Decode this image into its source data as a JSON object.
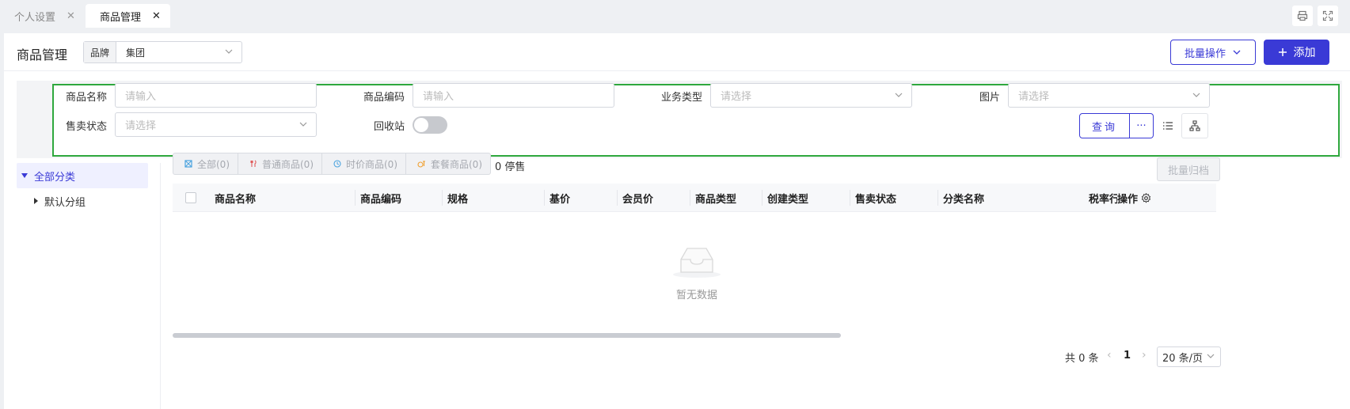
{
  "tabs": [
    {
      "label": "个人设置",
      "active": false
    },
    {
      "label": "商品管理",
      "active": true
    }
  ],
  "header": {
    "title": "商品管理",
    "brand_label": "品牌",
    "brand_value": "集团",
    "batch_label": "批量操作",
    "add_label": "添加"
  },
  "filters": {
    "product_name_label": "商品名称",
    "product_name_placeholder": "请输入",
    "product_code_label": "商品编码",
    "product_code_placeholder": "请输入",
    "business_type_label": "业务类型",
    "business_type_placeholder": "请选择",
    "image_label": "图片",
    "image_placeholder": "请选择",
    "sale_status_label": "售卖状态",
    "sale_status_placeholder": "请选择",
    "recycle_label": "回收站",
    "query_label": "查询",
    "more_label": "···"
  },
  "tree": {
    "all_label": "全部分类",
    "default_group_label": "默认分组"
  },
  "types": [
    {
      "label": "全部(0)",
      "icon": "grid-icon",
      "color": "#4aa3df"
    },
    {
      "label": "普通商品(0)",
      "icon": "fork-knife-icon",
      "color": "#e05b5b"
    },
    {
      "label": "时价商品(0)",
      "icon": "clock-icon",
      "color": "#4aa3df"
    },
    {
      "label": "套餐商品(0)",
      "icon": "combo-icon",
      "color": "#f0a030"
    }
  ],
  "stop_count": "0 停售",
  "archive_label": "批量归档",
  "table": {
    "columns": [
      "商品名称",
      "商品编码",
      "规格",
      "基价",
      "会员价",
      "商品类型",
      "创建类型",
      "售卖状态",
      "分类名称",
      "税率行"
    ],
    "action_label": "操作",
    "empty_text": "暂无数据"
  },
  "pagination": {
    "total": "共 0 条",
    "page": "1",
    "page_size": "20 条/页"
  },
  "colors": {
    "primary": "#3a3ad6",
    "highlight_border": "#2fa83e"
  }
}
